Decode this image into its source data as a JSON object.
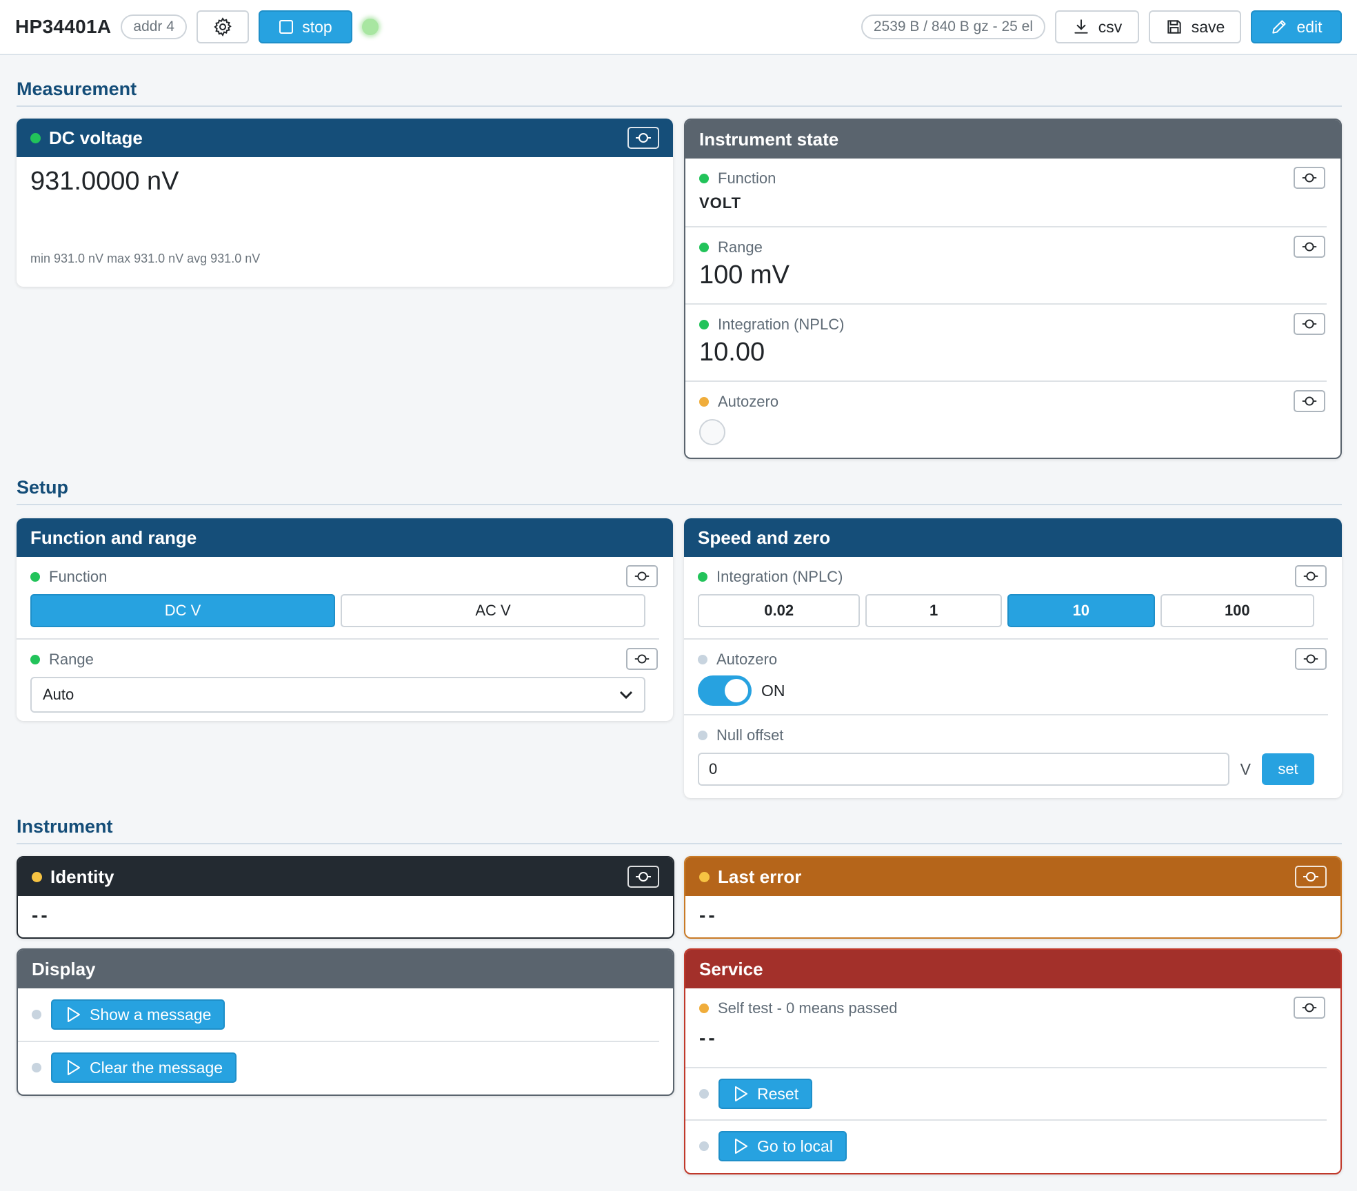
{
  "header": {
    "title": "HP34401A",
    "addr": "addr 4",
    "stop_label": "stop",
    "stats": "2539 B / 840 B gz - 25 el",
    "csv_label": "csv",
    "save_label": "save",
    "edit_label": "edit"
  },
  "sections": {
    "measurement": "Measurement",
    "setup": "Setup",
    "instrument": "Instrument"
  },
  "dc_voltage": {
    "title": "DC voltage",
    "value": "931.0000 nV",
    "stats": "min 931.0 nV max 931.0 nV avg 931.0 nV"
  },
  "instrument_state": {
    "title": "Instrument state",
    "rows": [
      {
        "label": "Function",
        "value": "VOLT",
        "status": "green"
      },
      {
        "label": "Range",
        "value": "100 mV",
        "status": "green"
      },
      {
        "label": "Integration (NPLC)",
        "value": "10.00",
        "status": "green"
      },
      {
        "label": "Autozero",
        "value": "",
        "status": "amber"
      }
    ]
  },
  "function_range": {
    "title": "Function and range",
    "function_label": "Function",
    "functions": [
      "DC V",
      "AC V"
    ],
    "function_selected": "DC V",
    "range_label": "Range",
    "range_value": "Auto"
  },
  "speed_zero": {
    "title": "Speed and zero",
    "nplc_label": "Integration (NPLC)",
    "nplc_options": [
      "0.02",
      "1",
      "10",
      "100"
    ],
    "nplc_selected": "10",
    "autozero_label": "Autozero",
    "autozero_state": "ON",
    "null_label": "Null offset",
    "null_value": "0",
    "null_unit": "V",
    "set_label": "set"
  },
  "identity": {
    "title": "Identity",
    "value": "--"
  },
  "last_error": {
    "title": "Last error",
    "value": "--"
  },
  "display": {
    "title": "Display",
    "show_label": "Show a message",
    "clear_label": "Clear the message"
  },
  "service": {
    "title": "Service",
    "selftest_label": "Self test - 0 means passed",
    "selftest_value": "--",
    "reset_label": "Reset",
    "local_label": "Go to local"
  },
  "colors": {
    "primary": "#27a2e0",
    "header_blue": "#154e79",
    "slate": "#5a646e",
    "dark": "#232a31",
    "amber": "#b5651a",
    "red": "#a3302a",
    "status_green": "#22c35a",
    "status_amber": "#f0ad3b"
  }
}
